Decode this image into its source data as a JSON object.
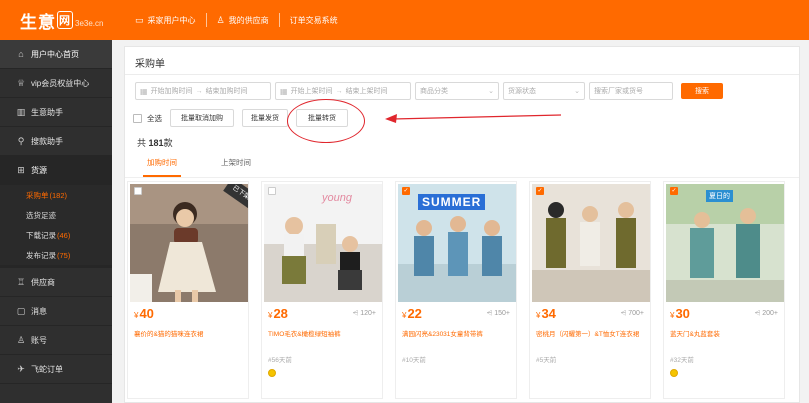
{
  "header": {
    "logo_main": "生意",
    "logo_badge": "网",
    "logo_sub": "3e3e.cn",
    "nav": [
      {
        "icon": "monitor-icon",
        "label": "采家用户中心"
      },
      {
        "icon": "user-icon",
        "label": "我的供应商"
      },
      {
        "icon": "",
        "label": "订单交易系统"
      }
    ]
  },
  "sidebar": {
    "items": [
      {
        "icon": "home-icon",
        "label": "用户中心首页"
      },
      {
        "icon": "crown-icon",
        "label": "vip会员权益中心"
      },
      {
        "icon": "chart-icon",
        "label": "生意助手"
      },
      {
        "icon": "search-icon",
        "label": "搜款助手"
      },
      {
        "icon": "grid-icon",
        "label": "货源"
      }
    ],
    "sub_items": [
      {
        "label": "采购单",
        "count": "(182)"
      },
      {
        "label": "选货足迹",
        "count": ""
      },
      {
        "label": "下载记录",
        "count": "(46)"
      },
      {
        "label": "发布记录",
        "count": "(75)"
      }
    ],
    "items_after": [
      {
        "icon": "store-icon",
        "label": "供应商"
      },
      {
        "icon": "message-icon",
        "label": "消息"
      },
      {
        "icon": "person-icon",
        "label": "账号"
      },
      {
        "icon": "plane-icon",
        "label": "飞蛇订单"
      }
    ]
  },
  "main": {
    "title": "采购单",
    "filters": {
      "join_start_placeholder": "开始加购时间",
      "join_end_placeholder": "结束加购时间",
      "shelf_start_placeholder": "开始上架时间",
      "shelf_end_placeholder": "结束上架时间",
      "arrow": "→",
      "category_placeholder": "商品分类",
      "status_placeholder": "货源状态",
      "search_placeholder": "搜索厂家或货号",
      "search_button": "搜索"
    },
    "actions": {
      "select_all": "全选",
      "cancel_join": "批量取消加购",
      "batch_ship": "批量发货",
      "batch_transfer": "批量转货"
    },
    "total_prefix": "共",
    "total_count": "181",
    "total_suffix": "款",
    "tabs": [
      "加购时间",
      "上架时间"
    ],
    "accent_color": "#ff6a00"
  },
  "products": [
    {
      "price": "40",
      "yen": "¥",
      "shares": "",
      "name": "襄价的&猫的猫咪连衣裙",
      "ago": "",
      "selected": false,
      "overlay": "已下架"
    },
    {
      "price": "28",
      "yen": "¥",
      "shares": "120+",
      "name": "TIMO毛衣&橄榄绿短袖裤",
      "ago": "#56天前",
      "selected": false,
      "overlay": "young"
    },
    {
      "price": "22",
      "yen": "¥",
      "shares": "150+",
      "name": "满园闪亮&23031女童背带裤",
      "ago": "#10天前",
      "selected": true,
      "overlay": "SUMMER"
    },
    {
      "price": "34",
      "yen": "¥",
      "shares": "700+",
      "name": "密桃月（闪耀第一）&T恤女T连衣裙",
      "ago": "#5天前",
      "selected": true,
      "overlay": ""
    },
    {
      "price": "30",
      "yen": "¥",
      "shares": "200+",
      "name": "蓝天门&丸蓝套装",
      "ago": "#32天前",
      "selected": true,
      "overlay": "夏日的"
    }
  ]
}
